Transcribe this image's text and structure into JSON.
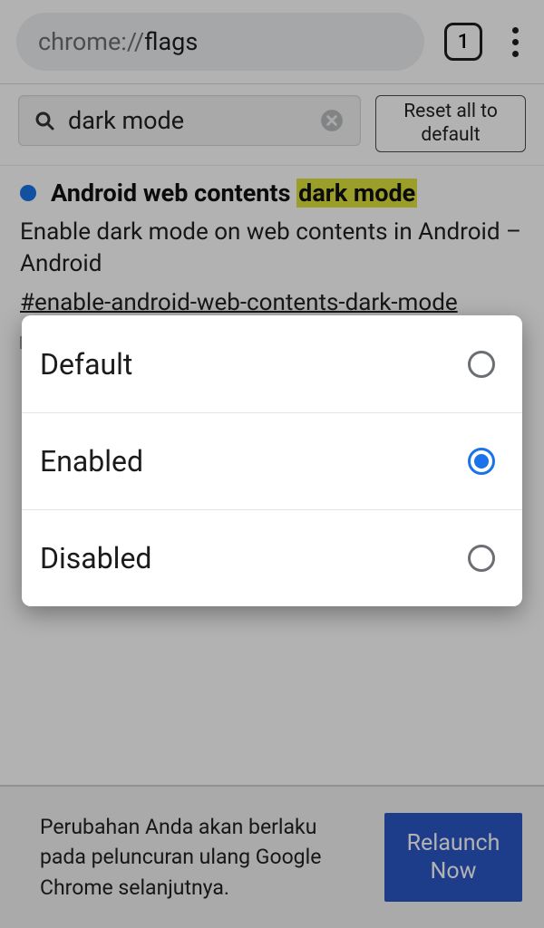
{
  "browser": {
    "url_prefix": "chrome://",
    "url_path": "flags",
    "tab_count": "1"
  },
  "search": {
    "value": "dark mode",
    "reset_label": "Reset all to default"
  },
  "flag": {
    "title_pre": "Android web contents ",
    "title_hl": "dark mode",
    "desc": "Enable dark mode on web contents in Android – Android",
    "id": "#enable-android-web-contents-dark-mode"
  },
  "relaunch": {
    "text": "Perubahan Anda akan berlaku pada peluncuran ulang Google Chrome selanjutnya.",
    "button": "Relaunch Now"
  },
  "popup": {
    "options": {
      "default": "Default",
      "enabled": "Enabled",
      "disabled": "Disabled"
    },
    "selected": "enabled"
  }
}
